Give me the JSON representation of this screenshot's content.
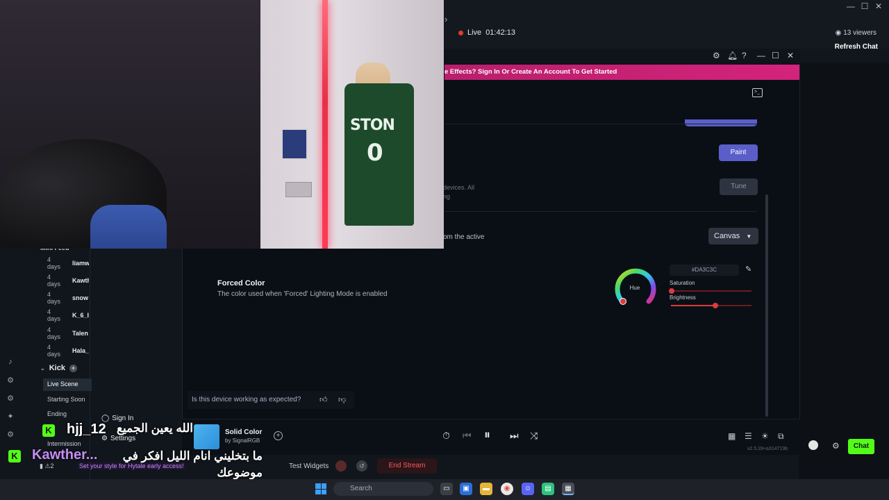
{
  "stream_app": {
    "live_label": "Live",
    "live_time": "01:42:13",
    "viewers": "13 viewers",
    "refresh_chat": "Refresh Chat",
    "minifeed_title": "Mini Feed",
    "feed": [
      {
        "time": "4 days",
        "name": "liamw"
      },
      {
        "time": "4 days",
        "name": "Kawth"
      },
      {
        "time": "4 days",
        "name": "snow"
      },
      {
        "time": "4 days",
        "name": "K_6_I"
      },
      {
        "time": "4 days",
        "name": "Talen"
      },
      {
        "time": "4 days",
        "name": "Hala_"
      }
    ],
    "kick_label": "Kick",
    "scenes": [
      "Live Scene",
      "Starting Soon",
      "Ending",
      "Intermission"
    ],
    "test_widgets": "Test Widgets",
    "end_stream": "End Stream",
    "chat_button": "Chat"
  },
  "signalrgb": {
    "banner": "e Effects? Sign In Or Create An Account To Get Started",
    "paint_button": "Paint",
    "tune_button": "Tune",
    "devices_text_line1": "devices. All",
    "devices_text_line2": "ng",
    "active_text": "om the active",
    "canvas_select": "Canvas",
    "forced_color_title": "Forced Color",
    "forced_color_desc": "The color used when 'Forced' Lighting Mode is enabled",
    "hue_label": "Hue",
    "hex_value": "#DA3C3C",
    "saturation_label": "Saturation",
    "saturation_value": 0.0,
    "brightness_label": "Brightness",
    "brightness_value": 0.55,
    "accent_color": "#5b5ec9",
    "selected_color": "#DA3C3C",
    "feedback_question": "Is this device working as expected?",
    "now_playing_title": "Solid Color",
    "now_playing_sub": "by SignalRGB",
    "version": "v2.5.28+a314719b",
    "sign_in": "Sign In",
    "settings": "Settings"
  },
  "webcam": {
    "jersey_text": "STON",
    "jersey_number": "0"
  },
  "overlay_chat": [
    {
      "badge": "K",
      "name": "hjj_12",
      "message": "الله يعين الجميع"
    },
    {
      "badge": "K",
      "name": "Kawther...",
      "message": "ما بتخليني انام الليل افكر في موضوعك"
    }
  ],
  "overlay_tip": "Set your style for Hytale early access!",
  "overlay_stats": "2",
  "taskbar": {
    "search_placeholder": "Search"
  }
}
